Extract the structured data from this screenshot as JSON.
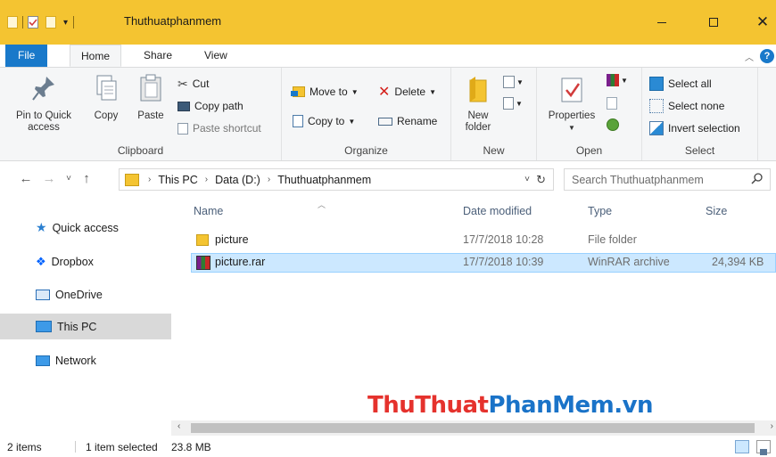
{
  "window": {
    "title": "Thuthuatphanmem",
    "accent_color": "#f4c431",
    "controls": [
      "minimize-icon",
      "maximize-icon",
      "close-icon"
    ]
  },
  "ribbon_tabs": [
    "File",
    "Home",
    "Share",
    "View"
  ],
  "ribbon": {
    "clipboard": {
      "label": "Clipboard",
      "pin_line1": "Pin to Quick",
      "pin_line2": "access",
      "copy": "Copy",
      "paste": "Paste",
      "cut": "Cut",
      "copy_path": "Copy path",
      "paste_shortcut": "Paste shortcut"
    },
    "organize": {
      "label": "Organize",
      "move_to": "Move to",
      "copy_to": "Copy to",
      "delete": "Delete",
      "rename": "Rename"
    },
    "new": {
      "label": "New",
      "new_folder_line1": "New",
      "new_folder_line2": "folder"
    },
    "open": {
      "label": "Open",
      "properties": "Properties"
    },
    "select": {
      "label": "Select",
      "select_all": "Select all",
      "select_none": "Select none",
      "invert_selection": "Invert selection"
    }
  },
  "address": {
    "breadcrumbs": [
      "This PC",
      "Data (D:)",
      "Thuthuatphanmem"
    ],
    "search_placeholder": "Search Thuthuatphanmem"
  },
  "nav_pane": [
    {
      "label": "Quick access",
      "icon": "star-icon"
    },
    {
      "label": "Dropbox",
      "icon": "dropbox-icon"
    },
    {
      "label": "OneDrive",
      "icon": "onedrive-icon"
    },
    {
      "label": "This PC",
      "icon": "computer-icon",
      "selected": true
    },
    {
      "label": "Network",
      "icon": "network-icon"
    }
  ],
  "file_list": {
    "columns": [
      "Name",
      "Date modified",
      "Type",
      "Size"
    ],
    "rows": [
      {
        "name": "picture",
        "date": "17/7/2018 10:28",
        "type": "File folder",
        "size": "",
        "icon": "folder-icon",
        "selected": false
      },
      {
        "name": "picture.rar",
        "date": "17/7/2018 10:39",
        "type": "WinRAR archive",
        "size": "24,394 KB",
        "icon": "winrar-icon",
        "selected": true
      }
    ]
  },
  "watermark": {
    "part1": "ThuThuat",
    "part2": "PhanMem.vn"
  },
  "status": {
    "items": "2 items",
    "selected": "1 item selected",
    "size": "23.8 MB"
  }
}
